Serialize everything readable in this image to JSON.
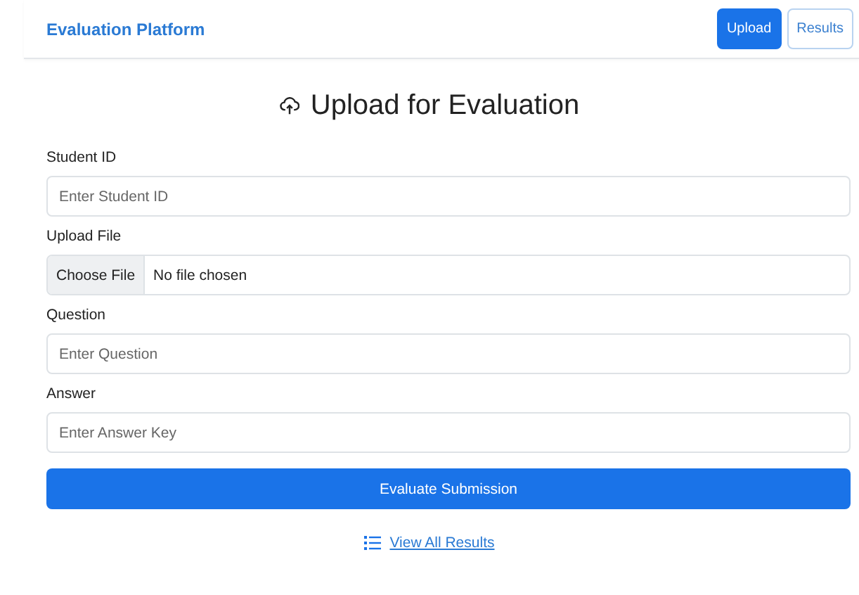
{
  "brand": "Evaluation Platform",
  "nav": [
    {
      "label": "Upload",
      "selected": true
    },
    {
      "label": "Results",
      "selected": false
    }
  ],
  "heading": "Upload for Evaluation",
  "fields": [
    {
      "kind": "text",
      "label": "Student ID",
      "placeholder": "Enter Student ID"
    },
    {
      "kind": "file",
      "label": "Upload File",
      "button": "Choose File",
      "value": "No file chosen"
    },
    {
      "kind": "text",
      "label": "Question",
      "placeholder": "Enter Question"
    },
    {
      "kind": "text",
      "label": "Answer",
      "placeholder": "Enter Answer Key"
    }
  ],
  "submit": "Evaluate Submission",
  "link": "View All Results"
}
